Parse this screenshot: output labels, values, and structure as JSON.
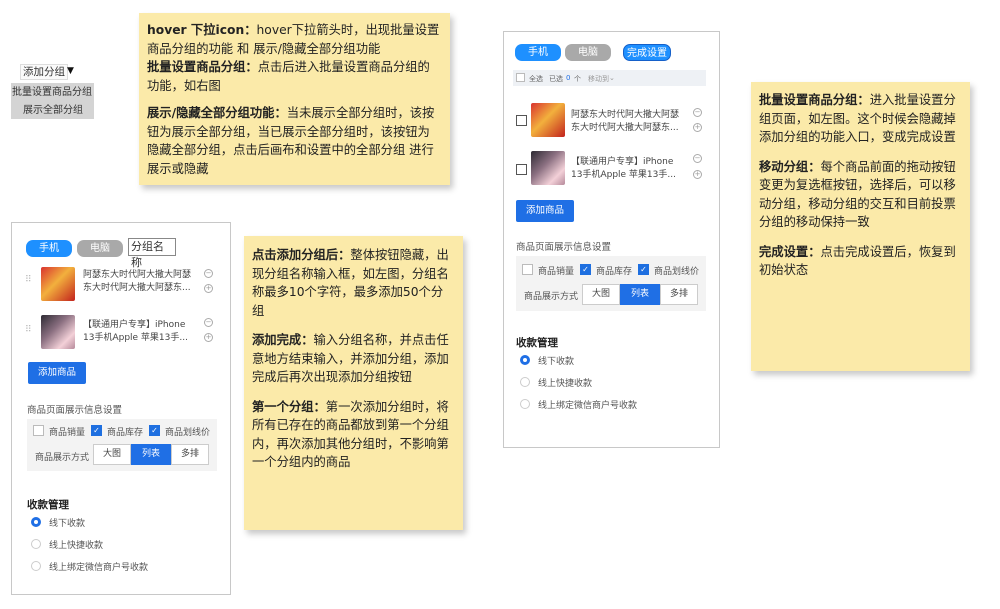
{
  "dropdown_demo": {
    "label": "添加分组",
    "arrow": "▼",
    "menu_items": [
      "批量设置商品分组",
      "展示全部分组"
    ]
  },
  "note_hover": {
    "line1_bold": "hover 下拉icon：",
    "line1": "hover下拉箭头时，出现批量设置商品分组的功能 和 展示/隐藏全部分组功能",
    "line2_bold": "批量设置商品分组：",
    "line2": "点击后进入批量设置商品分组的功能，如右图",
    "line3_bold": "展示/隐藏全部分组功能：",
    "line3": "当未展示全部分组时，该按钮为展示全部分组，当已展示全部分组时，该按钮为 隐藏全部分组，点击后画布和设置中的全部分组 进行展示或隐藏"
  },
  "note_add": {
    "p1_bold": "点击添加分组后：",
    "p1": "整体按钮隐藏，出现分组名称输入框，如左图，分组名称最多10个字符，最多添加50个分组",
    "p2_bold": "添加完成：",
    "p2": "输入分组名称，并点击任意地方结束输入，并添加分组，添加完成后再次出现添加分组按钮",
    "p3_bold": "第一个分组：",
    "p3": "第一次添加分组时，将所有已存在的商品都放到第一个分组内，再次添加其他分组时，不影响第一个分组内的商品"
  },
  "note_batch": {
    "p1_bold": "批量设置商品分组：",
    "p1": "进入批量设置分组页面，如左图。这个时候会隐藏掉添加分组的功能入口，变成完成设置",
    "p2_bold": "移动分组：",
    "p2": "每个商品前面的拖动按钮变更为复选框按钮，选择后，可以移动分组，移动分组的交互和目前投票分组的移动保持一致",
    "p3_bold": "完成设置：",
    "p3": "点击完成设置后，恢复到初始状态"
  },
  "editor_common": {
    "tab_phone": "手机",
    "tab_pc": "电脑",
    "products": [
      {
        "title": "阿瑟东大时代阿大撒大阿瑟东大时代阿大撒大阿瑟东..."
      },
      {
        "title": "【联通用户专享】iPhone 13手机Apple 苹果13手..."
      }
    ],
    "add_product": "添加商品",
    "display_settings_label": "商品页面展示信息设置",
    "opt_sales": "商品销量",
    "opt_stock": "商品库存",
    "opt_price": "商品划线价",
    "display_mode_label": "商品展示方式",
    "mode_large": "大图",
    "mode_list": "列表",
    "mode_multi": "多排",
    "payment_title": "收款管理",
    "pay_offline": "线下收款",
    "pay_quick": "线上快捷收款",
    "pay_wechat": "线上绑定微信商户号收款"
  },
  "editor_left": {
    "group_name_input": "分组名称"
  },
  "editor_right": {
    "finish_button": "完成设置",
    "select_all": "全选",
    "selected_prefix": "已选",
    "selected_count": "0",
    "selected_suffix": "个",
    "move_to": "移动到"
  },
  "colors": {
    "sticky": "#fbeaa9",
    "primary": "#1f6fe5",
    "pill_blue": "#1e90ff",
    "pill_gray": "#a9a9a9"
  }
}
